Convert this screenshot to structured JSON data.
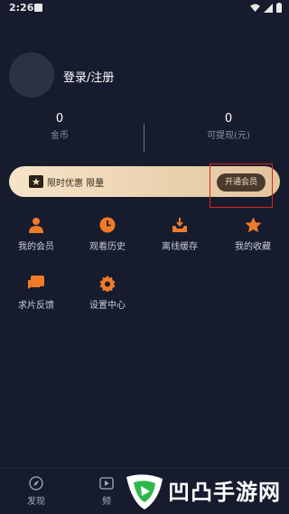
{
  "status_bar": {
    "time": "2:26"
  },
  "profile": {
    "login_label": "登录/注册"
  },
  "stats": [
    {
      "value": "0",
      "label": "金币"
    },
    {
      "value": "0",
      "label": "可提现(元)"
    }
  ],
  "vip_banner": {
    "promo_text": "限时优惠 限量",
    "button_label": "开通会员"
  },
  "menu": [
    {
      "label": "我的会员",
      "icon": "person-icon"
    },
    {
      "label": "观看历史",
      "icon": "clock-icon"
    },
    {
      "label": "离线缓存",
      "icon": "download-icon"
    },
    {
      "label": "我的收藏",
      "icon": "star-icon"
    },
    {
      "label": "求片反馈",
      "icon": "feedback-icon"
    },
    {
      "label": "设置中心",
      "icon": "gear-icon"
    }
  ],
  "bottom_nav": [
    {
      "label": "发现",
      "icon": "compass-icon"
    },
    {
      "label": "频",
      "icon": "video-icon"
    }
  ],
  "watermark": {
    "text": "凹凸手游网"
  },
  "colors": {
    "accent": "#f07a28",
    "background": "#161c2e",
    "banner": "#f3dcbb"
  }
}
